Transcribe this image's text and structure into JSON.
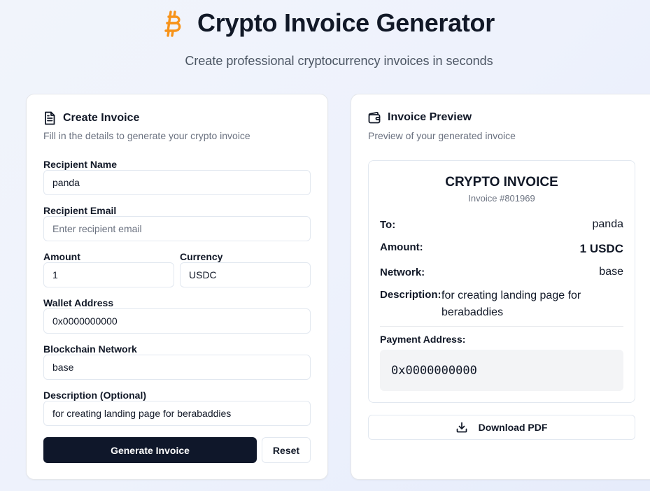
{
  "header": {
    "title": "Crypto Invoice Generator",
    "subtitle": "Create professional cryptocurrency invoices in seconds",
    "icon": "bitcoin-icon",
    "accent_color": "#f7931a"
  },
  "form": {
    "title": "Create Invoice",
    "description": "Fill in the details to generate your crypto invoice",
    "fields": {
      "recipient_name": {
        "label": "Recipient Name",
        "value": "panda",
        "placeholder": ""
      },
      "recipient_email": {
        "label": "Recipient Email",
        "value": "",
        "placeholder": "Enter recipient email"
      },
      "amount": {
        "label": "Amount",
        "value": "1"
      },
      "currency": {
        "label": "Currency",
        "value": "USDC"
      },
      "wallet_address": {
        "label": "Wallet Address",
        "value": "0x0000000000"
      },
      "network": {
        "label": "Blockchain Network",
        "value": "base"
      },
      "description": {
        "label": "Description (Optional)",
        "value": "for creating landing page for berabaddies"
      }
    },
    "buttons": {
      "generate": "Generate Invoice",
      "reset": "Reset"
    }
  },
  "preview": {
    "title": "Invoice Preview",
    "description": "Preview of your generated invoice",
    "invoice": {
      "heading": "CRYPTO INVOICE",
      "number": "Invoice #801969",
      "to_label": "To:",
      "to_value": "panda",
      "amount_label": "Amount:",
      "amount_value": "1 USDC",
      "network_label": "Network:",
      "network_value": "base",
      "description_label": "Description:",
      "description_value": "for creating landing page for berabaddies",
      "payment_label": "Payment Address:",
      "payment_value": "0x0000000000"
    },
    "download_label": "Download PDF"
  }
}
